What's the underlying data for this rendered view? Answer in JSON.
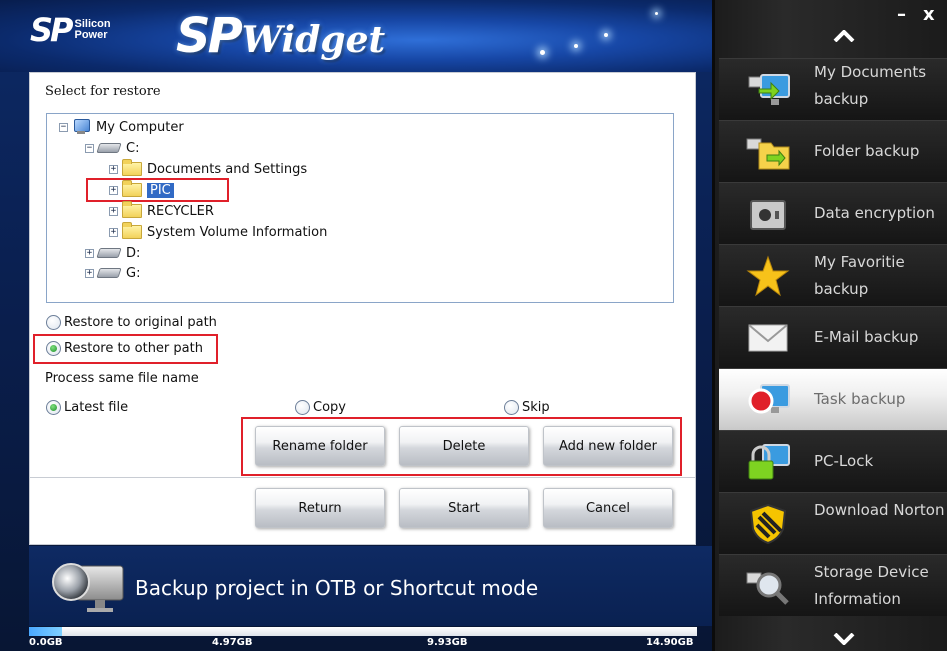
{
  "header": {
    "brand_mark": "SP",
    "brand_line1": "Silicon",
    "brand_line2": "Power",
    "title_big": "SP",
    "title_small": "Widget"
  },
  "main": {
    "select_label": "Select for restore",
    "tree": {
      "root": "My Computer",
      "drive_c": "C:",
      "folders": [
        "Documents and Settings",
        "PIC",
        "RECYCLER",
        "System Volume Information"
      ],
      "selected_folder": "PIC",
      "drive_d": "D:",
      "drive_g": "G:"
    },
    "restore_original": "Restore to original path",
    "restore_other": "Restore to other path",
    "restore_selected": "other",
    "process_label": "Process same file name",
    "opt_latest": "Latest file",
    "opt_copy": "Copy",
    "opt_skip": "Skip",
    "process_selected": "latest",
    "buttons": {
      "rename": "Rename folder",
      "delete": "Delete",
      "add": "Add new folder",
      "return": "Return",
      "start": "Start",
      "cancel": "Cancel"
    }
  },
  "info": {
    "text": "Backup project in OTB or Shortcut mode"
  },
  "capacity": {
    "labels": [
      "0.0GB",
      "4.97GB",
      "9.93GB",
      "14.90GB"
    ],
    "used_fraction": 0.05
  },
  "window": {
    "minimize": "–",
    "close": "x"
  },
  "sidebar": {
    "items": [
      {
        "label": "My Documents backup",
        "icon": "my-documents-icon"
      },
      {
        "label": "Folder backup",
        "icon": "folder-backup-icon"
      },
      {
        "label": "Data encryption",
        "icon": "safe-icon"
      },
      {
        "label": "My Favoritie backup",
        "icon": "star-icon"
      },
      {
        "label": "E-Mail backup",
        "icon": "envelope-icon"
      },
      {
        "label": "Task backup",
        "icon": "task-icon"
      },
      {
        "label": "PC-Lock",
        "icon": "lock-icon"
      },
      {
        "label": "Download Norton",
        "icon": "norton-shield-icon"
      },
      {
        "label": "Storage Device Information",
        "icon": "storage-info-icon"
      }
    ],
    "active_index": 5
  },
  "colors": {
    "accent_red": "#e0202a",
    "selection_blue": "#316ac5",
    "header_blue": "#1747a6",
    "sidebar_dark": "#1c1c1c"
  }
}
